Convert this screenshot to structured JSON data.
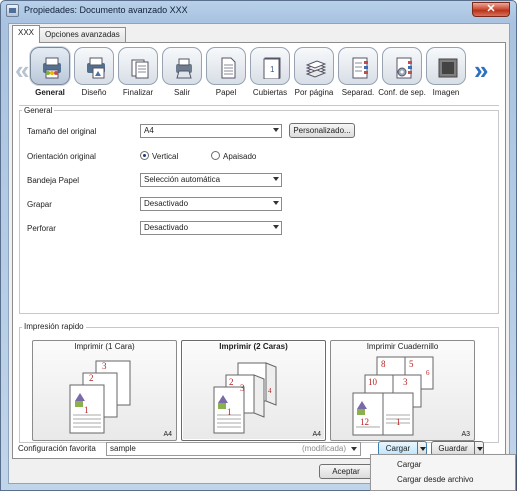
{
  "window": {
    "title": "Propiedades: Documento avanzado XXX",
    "close_glyph": "✕"
  },
  "tabs": [
    {
      "label": "XXX",
      "active": true
    },
    {
      "label": "Opciones avanzadas",
      "active": false
    }
  ],
  "categories": [
    {
      "label": "General",
      "icon": "general-icon",
      "active": true
    },
    {
      "label": "Diseño",
      "icon": "layout-icon",
      "active": false
    },
    {
      "label": "Finalizar",
      "icon": "finishing-icon",
      "active": false
    },
    {
      "label": "Salir",
      "icon": "output-icon",
      "active": false
    },
    {
      "label": "Papel",
      "icon": "paper-icon",
      "active": false
    },
    {
      "label": "Cubiertas",
      "icon": "covers-icon",
      "active": false
    },
    {
      "label": "Por página",
      "icon": "per-page-icon",
      "active": false
    },
    {
      "label": "Separad.",
      "icon": "separator-icon",
      "active": false
    },
    {
      "label": "Conf. de sep.",
      "icon": "separator-settings-icon",
      "active": false
    },
    {
      "label": "Imagen",
      "icon": "image-icon",
      "active": false
    }
  ],
  "nav": {
    "prev_glyph": "«",
    "next_glyph": "»"
  },
  "general": {
    "legend": "General",
    "paper_size": {
      "label": "Tamaño del original",
      "value": "A4",
      "custom_button": "Personalizado..."
    },
    "orientation": {
      "label": "Orientación original",
      "options": [
        "Vertical",
        "Apaisado"
      ],
      "selected": "Vertical"
    },
    "tray": {
      "label": "Bandeja Papel",
      "value": "Selección automática"
    },
    "staple": {
      "label": "Grapar",
      "value": "Desactivado"
    },
    "punch": {
      "label": "Perforar",
      "value": "Desactivado"
    }
  },
  "quick_print": {
    "legend": "Impresión rapido",
    "presets": [
      {
        "title": "Imprimir (1 Cara)",
        "size": "A4",
        "selected": false,
        "page_numbers": [
          "3",
          "2",
          "1"
        ]
      },
      {
        "title": "Imprimir (2 Caras)",
        "size": "A4",
        "selected": true,
        "page_numbers": [
          "3",
          "4",
          "2",
          "1"
        ]
      },
      {
        "title": "Imprimir Cuadernillo",
        "size": "A3",
        "selected": false,
        "page_numbers": [
          "8",
          "5",
          "6",
          "10",
          "3",
          "12",
          "1"
        ]
      }
    ]
  },
  "favorites": {
    "label": "Configuración favorita",
    "value": "sample",
    "status": "(modificada)",
    "load_button": "Cargar",
    "save_button": "Guardar"
  },
  "footer": {
    "accept_button": "Aceptar"
  },
  "load_menu": {
    "items": [
      "Cargar",
      "Cargar desde archivo"
    ]
  },
  "colors": {
    "accent": "#2f6fc0",
    "page_number": "#b22222",
    "close": "#c9462d"
  }
}
